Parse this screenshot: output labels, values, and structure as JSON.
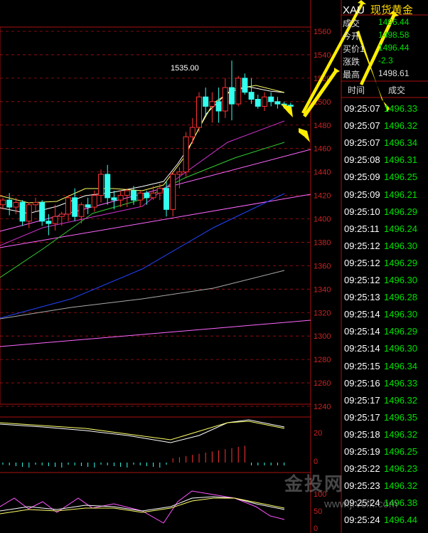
{
  "header": {
    "symbol": "XAU",
    "name": "现货黄金"
  },
  "quote": [
    {
      "label": "成交",
      "value": "1496.44",
      "color": "#00e000"
    },
    {
      "label": "今开",
      "value": "1498.58",
      "color": "#00e000"
    },
    {
      "label": "买价1",
      "value": "1496.44",
      "color": "#00e000"
    },
    {
      "label": "涨跌",
      "value": "-2.3",
      "color": "#00e000"
    },
    {
      "label": "最高",
      "value": "1498.61",
      "color": "#dddddd"
    }
  ],
  "ticks_header": {
    "time": "时间",
    "price": "成交"
  },
  "ticks": [
    {
      "time": "09:25:07",
      "price": "1496.33"
    },
    {
      "time": "09:25:07",
      "price": "1496.32"
    },
    {
      "time": "09:25:07",
      "price": "1496.34"
    },
    {
      "time": "09:25:08",
      "price": "1496.31"
    },
    {
      "time": "09:25:09",
      "price": "1496.25"
    },
    {
      "time": "09:25:09",
      "price": "1496.21"
    },
    {
      "time": "09:25:10",
      "price": "1496.29"
    },
    {
      "time": "09:25:11",
      "price": "1496.24"
    },
    {
      "time": "09:25:12",
      "price": "1496.30"
    },
    {
      "time": "09:25:12",
      "price": "1496.29"
    },
    {
      "time": "09:25:12",
      "price": "1496.30"
    },
    {
      "time": "09:25:13",
      "price": "1496.28"
    },
    {
      "time": "09:25:14",
      "price": "1496.30"
    },
    {
      "time": "09:25:14",
      "price": "1496.29"
    },
    {
      "time": "09:25:14",
      "price": "1496.30"
    },
    {
      "time": "09:25:15",
      "price": "1496.34"
    },
    {
      "time": "09:25:16",
      "price": "1496.33"
    },
    {
      "time": "09:25:17",
      "price": "1496.32"
    },
    {
      "time": "09:25:17",
      "price": "1496.35"
    },
    {
      "time": "09:25:18",
      "price": "1496.32"
    },
    {
      "time": "09:25:19",
      "price": "1496.25"
    },
    {
      "time": "09:25:22",
      "price": "1496.23"
    },
    {
      "time": "09:25:23",
      "price": "1496.32"
    },
    {
      "time": "09:25:24",
      "price": "1496.38"
    },
    {
      "time": "09:25:24",
      "price": "1496.44"
    }
  ],
  "watermark": {
    "brand": "金投网",
    "url": "www.jrvcfk.com"
  },
  "chart_data": {
    "type": "candlestick",
    "price_axis": [
      "1560",
      "1540",
      "1520",
      "1500",
      "1480",
      "1460",
      "1440",
      "1420",
      "1400",
      "1380",
      "1360",
      "1340",
      "1320",
      "1300",
      "1280",
      "1260",
      "1240"
    ],
    "ylim": [
      1240,
      1560
    ],
    "annotation": "1535.00",
    "macd_axis": [
      "20",
      "0"
    ],
    "kdj_axis": [
      "100",
      "50",
      "0"
    ],
    "candles": [
      [
        1412,
        1418,
        1408,
        1416
      ],
      [
        1416,
        1422,
        1403,
        1410
      ],
      [
        1410,
        1418,
        1404,
        1414
      ],
      [
        1414,
        1416,
        1394,
        1398
      ],
      [
        1398,
        1414,
        1392,
        1412
      ],
      [
        1412,
        1418,
        1406,
        1414
      ],
      [
        1414,
        1416,
        1394,
        1398
      ],
      [
        1398,
        1404,
        1386,
        1396
      ],
      [
        1396,
        1412,
        1390,
        1402
      ],
      [
        1402,
        1406,
        1394,
        1404
      ],
      [
        1404,
        1420,
        1398,
        1418
      ],
      [
        1418,
        1426,
        1398,
        1402
      ],
      [
        1402,
        1414,
        1396,
        1412
      ],
      [
        1412,
        1418,
        1404,
        1410
      ],
      [
        1410,
        1424,
        1406,
        1420
      ],
      [
        1420,
        1442,
        1414,
        1438
      ],
      [
        1438,
        1446,
        1412,
        1418
      ],
      [
        1418,
        1424,
        1408,
        1416
      ],
      [
        1416,
        1424,
        1410,
        1420
      ],
      [
        1420,
        1426,
        1410,
        1424
      ],
      [
        1424,
        1428,
        1412,
        1416
      ],
      [
        1416,
        1424,
        1410,
        1422
      ],
      [
        1422,
        1424,
        1412,
        1418
      ],
      [
        1418,
        1428,
        1416,
        1422
      ],
      [
        1422,
        1430,
        1416,
        1426
      ],
      [
        1426,
        1432,
        1402,
        1408
      ],
      [
        1408,
        1440,
        1402,
        1438
      ],
      [
        1438,
        1444,
        1426,
        1440
      ],
      [
        1440,
        1474,
        1436,
        1470
      ],
      [
        1470,
        1486,
        1464,
        1478
      ],
      [
        1478,
        1508,
        1474,
        1504
      ],
      [
        1504,
        1512,
        1488,
        1496
      ],
      [
        1496,
        1508,
        1482,
        1500
      ],
      [
        1500,
        1512,
        1482,
        1492
      ],
      [
        1492,
        1520,
        1486,
        1512
      ],
      [
        1512,
        1535,
        1484,
        1498
      ],
      [
        1498,
        1522,
        1496,
        1520
      ],
      [
        1520,
        1524,
        1506,
        1508
      ],
      [
        1508,
        1520,
        1498,
        1502
      ],
      [
        1502,
        1506,
        1494,
        1496
      ],
      [
        1496,
        1508,
        1492,
        1504
      ],
      [
        1504,
        1508,
        1496,
        1500
      ],
      [
        1500,
        1504,
        1494,
        1498
      ],
      [
        1498,
        1500,
        1494,
        1497
      ],
      [
        1497,
        1499,
        1495,
        1496
      ]
    ]
  }
}
